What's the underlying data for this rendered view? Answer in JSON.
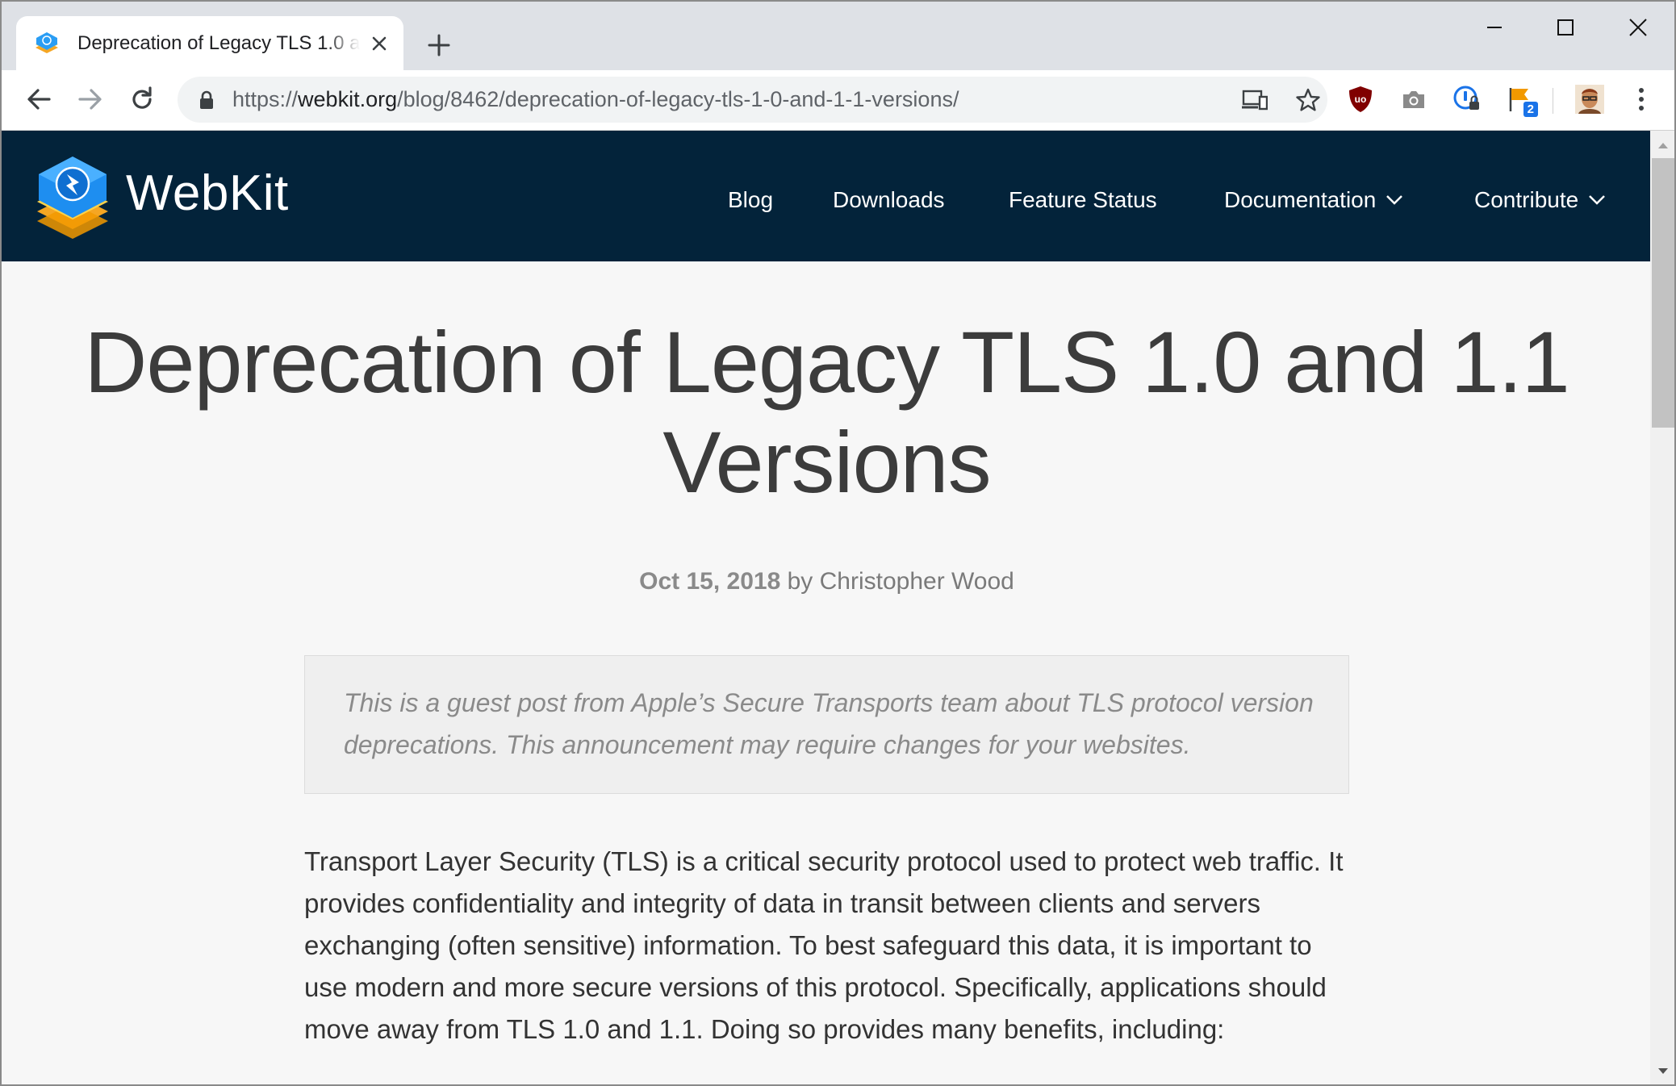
{
  "browser": {
    "tab": {
      "title": "Deprecation of Legacy TLS 1.0 and 1.1 Versions",
      "favicon": "webkit-icon",
      "close_icon": "close-icon"
    },
    "new_tab_icon": "plus-icon",
    "window_controls": [
      "minimize-icon",
      "maximize-icon",
      "close-icon"
    ],
    "nav_icons": [
      "back-arrow-icon",
      "forward-arrow-icon",
      "reload-icon"
    ],
    "url_scheme": "https://",
    "url_host": "webkit.org",
    "url_path": "/blog/8462/deprecation-of-legacy-tls-1-0-and-1-1-versions/",
    "omnibox_icons": [
      "lock-icon",
      "cast-icon",
      "star-icon"
    ],
    "extensions": [
      {
        "name": "ublock-icon",
        "color": "#800000"
      },
      {
        "name": "camera-icon",
        "color": "#8a8a8a"
      },
      {
        "name": "password-manager-icon",
        "color": "#1a73e8"
      },
      {
        "name": "flag-icon",
        "color": "#f29900",
        "badge": "2"
      },
      {
        "name": "avatar",
        "color": "#c98a5a"
      }
    ],
    "menu_icon": "kebab-menu-icon"
  },
  "site": {
    "brand": "WebKit",
    "header_color": "#03233a",
    "nav": {
      "blog": "Blog",
      "downloads": "Downloads",
      "feature_status": "Feature Status",
      "documentation": "Documentation",
      "contribute": "Contribute"
    }
  },
  "article": {
    "title": "Deprecation of Legacy TLS 1.0 and 1.1 Versions",
    "date": "Oct 15, 2018",
    "by": " by ",
    "author": "Christopher Wood",
    "intro": "This is a guest post from Apple’s Secure Transports team about TLS protocol version deprecations. This announcement may require changes for your websites.",
    "body": "Transport Layer Security (TLS) is a critical security protocol used to protect web traffic. It provides confidentiality and integrity of data in transit between clients and servers exchanging (often sensitive) information. To best safeguard this data, it is important to use modern and more secure versions of this protocol. Specifically, applications should move away from TLS 1.0 and 1.1. Doing so provides many benefits, including:"
  }
}
